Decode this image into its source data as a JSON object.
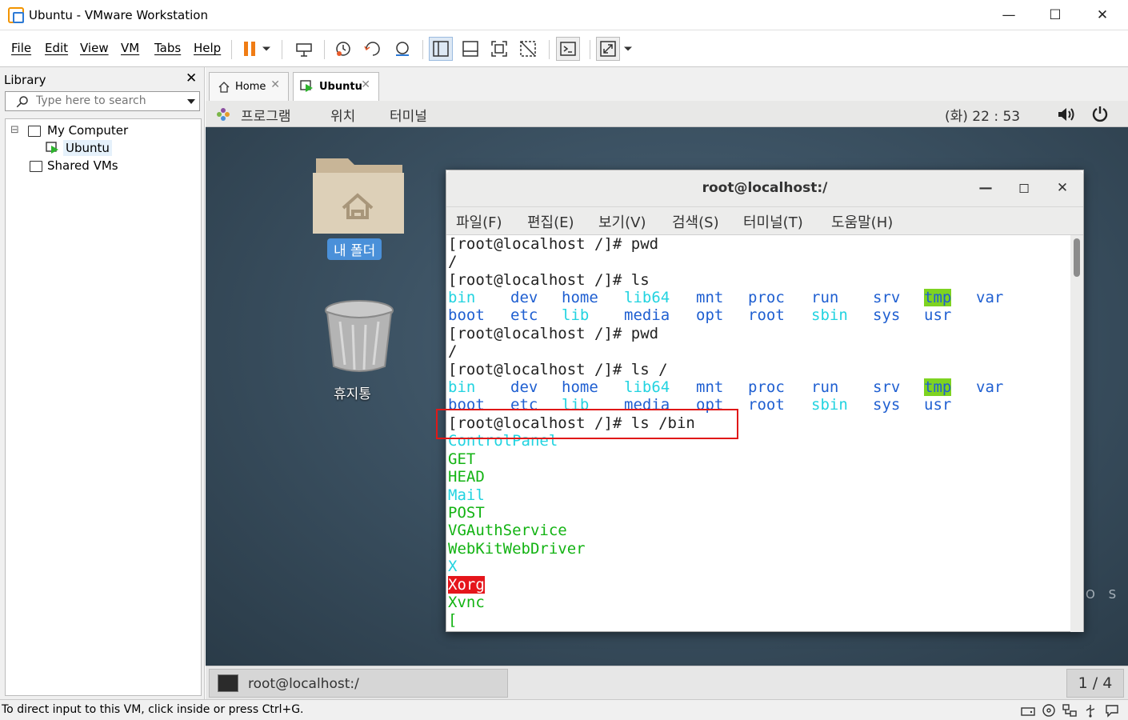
{
  "window": {
    "title": "Ubuntu - VMware Workstation",
    "controls": {
      "minimize": "—",
      "maximize": "☐",
      "close": "✕"
    }
  },
  "menubar": {
    "items": [
      "File",
      "Edit",
      "View",
      "VM",
      "Tabs",
      "Help"
    ]
  },
  "toolbar": {
    "icons": [
      "pause-icon",
      "dropdown-icon",
      "send-ctrl-alt-del-icon",
      "snapshot-take-icon",
      "snapshot-revert-icon",
      "snapshot-manager-icon",
      "library-view-icon",
      "thumbnail-bar-icon",
      "full-screen-icon",
      "unity-icon",
      "console-view-icon",
      "stretch-view-icon"
    ]
  },
  "library": {
    "title": "Library",
    "close": "✕",
    "search_placeholder": "Type here to search",
    "tree": {
      "my_computer": "My Computer",
      "ubuntu": "Ubuntu",
      "shared_vms": "Shared VMs",
      "expander": "⊟"
    }
  },
  "tabs": [
    {
      "label": "Home",
      "close": "✕"
    },
    {
      "label": "Ubuntu",
      "close": "✕"
    }
  ],
  "guest": {
    "topbar": {
      "applications": "프로그램",
      "places": "위치",
      "terminal": "터미널",
      "clock": "(화) 22 : 53"
    },
    "desktop": {
      "folder_label": "내 폴더",
      "trash_label": "휴지통",
      "watermark": "O S"
    },
    "terminal": {
      "title": "root@localhost:/",
      "controls": {
        "minimize": "—",
        "maximize": "◻",
        "close": "✕"
      },
      "menu": [
        "파일(F)",
        "편집(E)",
        "보기(V)",
        "검색(S)",
        "터미널(T)",
        "도움말(H)"
      ],
      "prompts": [
        "[root@localhost /]# pwd",
        "[root@localhost /]# ls",
        "[root@localhost /]# pwd",
        "[root@localhost /]# ls /",
        "[root@localhost /]# ls /bin"
      ],
      "pwd_output": "/",
      "ls_row1": [
        "bin",
        "dev",
        "home",
        "lib64",
        "mnt",
        "proc",
        "run",
        "srv",
        "tmp",
        "var"
      ],
      "ls_row2": [
        "boot",
        "etc",
        "lib",
        "media",
        "opt",
        "root",
        "sbin",
        "sys",
        "usr"
      ],
      "bin_list": [
        "ControlPanel",
        "GET",
        "HEAD",
        "Mail",
        "POST",
        "VGAuthService",
        "WebKitWebDriver",
        "X",
        "Xorg",
        "Xvnc",
        "["
      ]
    },
    "taskbar": {
      "item": "root@localhost:/",
      "workspace": "1 / 4"
    }
  },
  "statusbar": {
    "text": "To direct input to this VM, click inside or press Ctrl+G.",
    "icons": [
      "hard-disk-icon",
      "cd-dvd-icon",
      "network-icon",
      "usb-icon",
      "message-icon"
    ]
  }
}
